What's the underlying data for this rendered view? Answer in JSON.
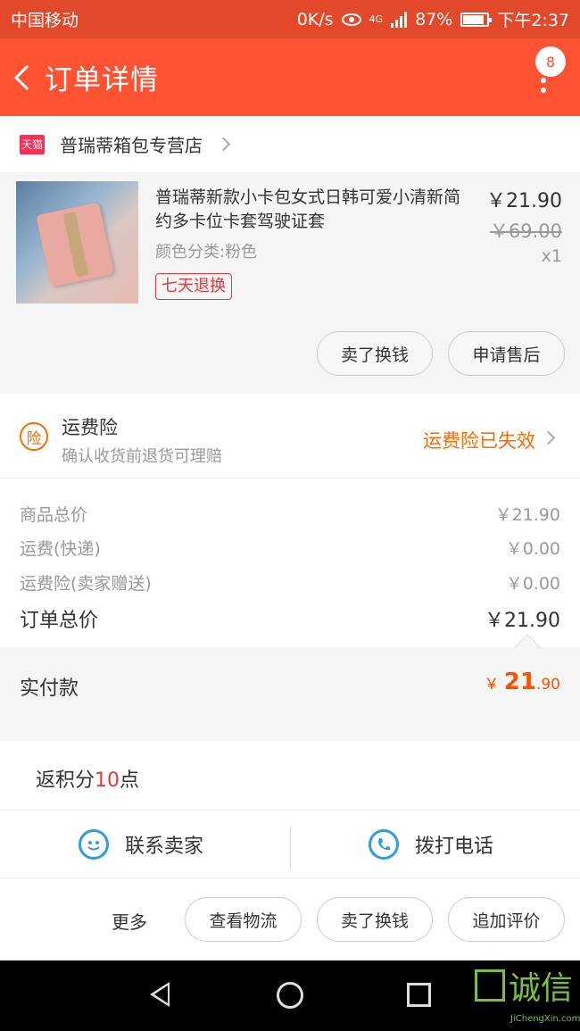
{
  "status_bar": {
    "carrier": "中国移动",
    "speed": "0K/s",
    "network": "4G",
    "battery": "87%",
    "time": "下午2:37"
  },
  "header": {
    "title": "订单详情",
    "badge": "8"
  },
  "shop": {
    "badge": "天猫",
    "name": "普瑞蒂箱包专营店"
  },
  "item": {
    "name": "普瑞蒂新款小卡包女式日韩可爱小清新简约多卡位卡套驾驶证套",
    "spec": "颜色分类:粉色",
    "tag": "七天退换",
    "price": "￥21.90",
    "original_price": "￥69.00",
    "quantity": "x1",
    "buttons": [
      "卖了换钱",
      "申请售后"
    ]
  },
  "insurance": {
    "icon": "险",
    "title": "运费险",
    "subtitle": "确认收货前退货可理赔",
    "status": "运费险已失效"
  },
  "fees": [
    {
      "label": "商品总价",
      "value": "￥21.90"
    },
    {
      "label": "运费(快递)",
      "value": "￥0.00"
    },
    {
      "label": "运费险(卖家赠送)",
      "value": "￥0.00"
    }
  ],
  "order_total": {
    "label": "订单总价",
    "value": "￥21.90"
  },
  "paid": {
    "label": "实付款",
    "currency": "￥",
    "integer": "21",
    "decimal": ".90"
  },
  "points": {
    "prefix": "返积分",
    "number": "10",
    "suffix": "点"
  },
  "contact": {
    "seller": "联系卖家",
    "phone": "拨打电话"
  },
  "actions": {
    "more": "更多",
    "buttons": [
      "查看物流",
      "卖了换钱",
      "追加评价"
    ]
  },
  "watermark": {
    "text": "诚信",
    "sub": "JiChengXin.com"
  },
  "colors": {
    "header": "#ff5232",
    "accent": "#ff5000",
    "insurance": "#ff6a00",
    "contact_icon": "#2e9de0"
  }
}
